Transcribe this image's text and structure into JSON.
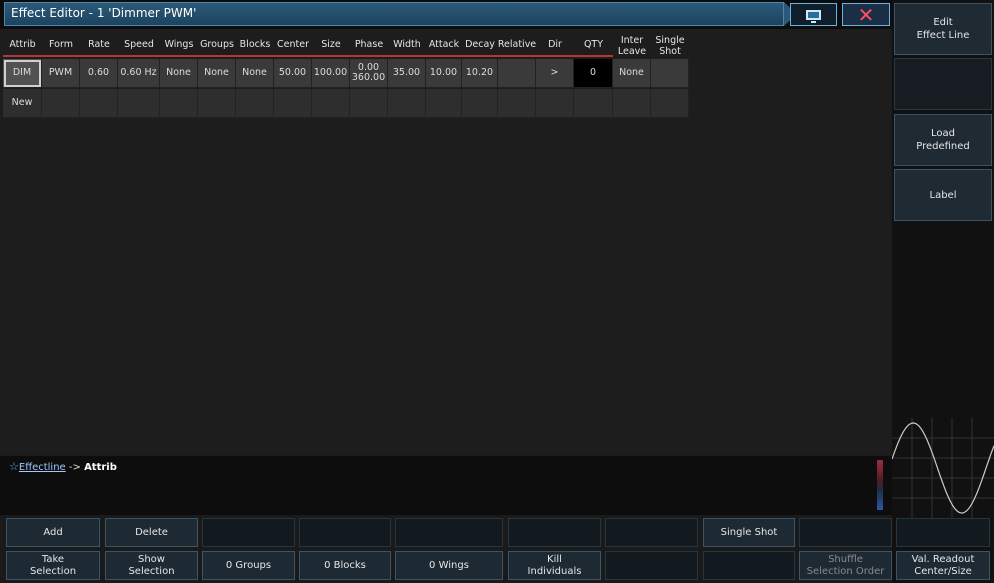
{
  "window": {
    "title": "Effect Editor - 1 'Dimmer PWM'"
  },
  "columns": [
    {
      "label": "Attrib"
    },
    {
      "label": "Form"
    },
    {
      "label": "Rate"
    },
    {
      "label": "Speed"
    },
    {
      "label": "Wings"
    },
    {
      "label": "Groups"
    },
    {
      "label": "Blocks"
    },
    {
      "label": "Center"
    },
    {
      "label": "Size"
    },
    {
      "label": "Phase"
    },
    {
      "label": "Width"
    },
    {
      "label": "Attack"
    },
    {
      "label": "Decay"
    },
    {
      "label": "Relative"
    },
    {
      "label": "Dir"
    },
    {
      "label": "QTY"
    },
    {
      "label": "Inter\nLeave"
    },
    {
      "label": "Single\nShot"
    }
  ],
  "rows": [
    [
      "DIM",
      "PWM",
      "0.60",
      "0.60 Hz",
      "None",
      "None",
      "None",
      "50.00",
      "100.00",
      "0.00\n360.00",
      "35.00",
      "10.00",
      "10.20",
      "",
      ">",
      "0",
      "None",
      ""
    ],
    [
      "New",
      "",
      "",
      "",
      "",
      "",
      "",
      "",
      "",
      "",
      "",
      "",
      "",
      "",
      "",
      "",
      "",
      ""
    ]
  ],
  "command_line": {
    "link": "Effectline",
    "arrow": " -> ",
    "current": "Attrib"
  },
  "right_panel": {
    "edit_effect_line": "Edit\nEffect Line",
    "load_predefined": "Load\nPredefined",
    "label": "Label"
  },
  "bottom_row1": {
    "add": "Add",
    "delete": "Delete",
    "single_shot": "Single Shot"
  },
  "bottom_row2": {
    "take_selection": "Take\nSelection",
    "show_selection": "Show\nSelection",
    "groups": "0 Groups",
    "blocks": "0 Blocks",
    "wings": "0 Wings",
    "kill_individuals": "Kill\nIndividuals",
    "shuffle": "Shuffle\nSelection Order",
    "val_readout": "Val. Readout\nCenter/Size"
  },
  "icons": {
    "window_icon": "monitor-icon",
    "close_icon": "close-icon",
    "star": "star-icon"
  },
  "colors": {
    "accent": "#2b5a78",
    "close": "#ff4d6b",
    "header_underline": "#b83333"
  }
}
